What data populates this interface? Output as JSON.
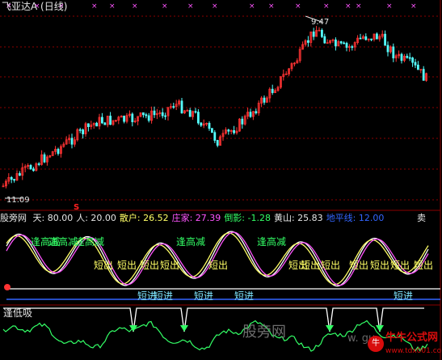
{
  "header": {
    "title": "飞亚达A (日线)",
    "high_label": "9.47",
    "low_label": "11.09",
    "signal_mark": "S"
  },
  "indicator": {
    "name": "股旁网",
    "items": [
      {
        "label": "天:",
        "value": "80.00",
        "color": "#e6e6e6"
      },
      {
        "label": "人:",
        "value": "20.00",
        "color": "#e6e6e6"
      },
      {
        "label": "散户:",
        "value": "26.52",
        "color": "#ffff66"
      },
      {
        "label": "庄家:",
        "value": "27.39",
        "color": "#ff55ff"
      },
      {
        "label": "倒影:",
        "value": "-1.28",
        "color": "#33ff66"
      },
      {
        "label": "黄山:",
        "value": "25.83",
        "color": "#e6e6e6"
      },
      {
        "label": "地平线:",
        "value": "12.00",
        "color": "#3366ff"
      }
    ],
    "menu_char": "卖"
  },
  "signals": {
    "high": "逢高减",
    "sell": "短出",
    "buy": "短进"
  },
  "sub_panel": {
    "title": "逢低吸"
  },
  "watermark": {
    "text1": "股旁网",
    "text2": "w.  gu"
  },
  "logo": {
    "name": "牛牛公式网",
    "url": "www.tdx001.com",
    "badge": "牛"
  },
  "colors": {
    "up_candle": "#ff3333",
    "down_candle": "#54ffff",
    "grid": "#8b0000",
    "white_line": "#ffffff",
    "yellow_line": "#ffff66",
    "magenta_line": "#ff55ff",
    "green_line": "#33ff66",
    "blue_line": "#3366ff"
  }
}
